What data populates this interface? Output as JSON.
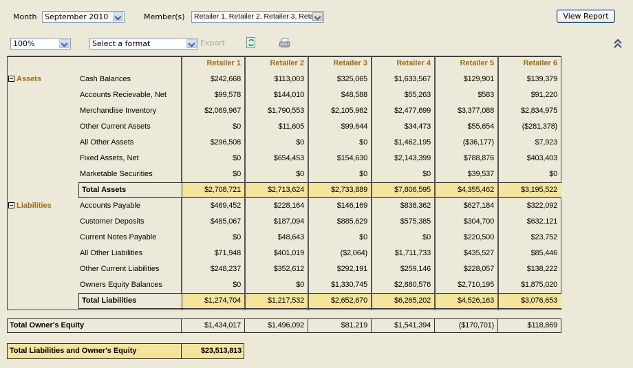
{
  "toolbar": {
    "month_label": "Month",
    "month_value": "September 2010",
    "members_label": "Member(s)",
    "members_value": "Retailer 1, Retailer 2, Retailer 3, Retail",
    "view_report_label": "View Report",
    "zoom_value": "100%",
    "format_value": "Select a format",
    "export_label": "Export",
    "icons": [
      "refresh-icon",
      "print-icon",
      "collapse-up-icon"
    ]
  },
  "report": {
    "columns": [
      "Retailer 1",
      "Retailer 2",
      "Retailer 3",
      "Retailer 4",
      "Retailer 5",
      "Retailer 6"
    ],
    "assets": {
      "label": "Assets",
      "rows": [
        {
          "label": "Cash Balances",
          "values": [
            "$242,668",
            "$113,003",
            "$325,065",
            "$1,633,567",
            "$129,901",
            "$139,379"
          ]
        },
        {
          "label": "Accounts Recievable, Net",
          "values": [
            "$99,578",
            "$144,010",
            "$48,588",
            "$55,263",
            "$583",
            "$91,220"
          ]
        },
        {
          "label": "Merchandise Inventory",
          "values": [
            "$2,069,967",
            "$1,790,553",
            "$2,105,962",
            "$2,477,699",
            "$3,377,088",
            "$2,834,975"
          ]
        },
        {
          "label": "Other Current Assets",
          "values": [
            "$0",
            "$11,605",
            "$99,644",
            "$34,473",
            "$55,654",
            "($281,378)"
          ]
        },
        {
          "label": "All Other Assets",
          "values": [
            "$296,508",
            "$0",
            "$0",
            "$1,462,195",
            "($36,177)",
            "$7,923"
          ]
        },
        {
          "label": "Fixed Assets, Net",
          "values": [
            "$0",
            "$654,453",
            "$154,630",
            "$2,143,399",
            "$788,876",
            "$403,403"
          ]
        },
        {
          "label": "Marketable Securities",
          "values": [
            "$0",
            "$0",
            "$0",
            "$0",
            "$39,537",
            "$0"
          ]
        }
      ],
      "total": {
        "label": "Total Assets",
        "values": [
          "$2,708,721",
          "$2,713,624",
          "$2,733,889",
          "$7,806,595",
          "$4,355,462",
          "$3,195,522"
        ]
      }
    },
    "liabilities": {
      "label": "Liabilities",
      "rows": [
        {
          "label": "Accounts Payable",
          "values": [
            "$469,452",
            "$228,164",
            "$146,169",
            "$838,362",
            "$627,184",
            "$322,092"
          ]
        },
        {
          "label": "Customer Deposits",
          "values": [
            "$485,067",
            "$187,094",
            "$885,629",
            "$575,385",
            "$304,700",
            "$632,121"
          ]
        },
        {
          "label": "Current Notes Payable",
          "values": [
            "$0",
            "$48,643",
            "$0",
            "$0",
            "$220,500",
            "$23,752"
          ]
        },
        {
          "label": "All Other Liabilities",
          "values": [
            "$71,948",
            "$401,019",
            "($2,064)",
            "$1,711,733",
            "$435,527",
            "$85,446"
          ]
        },
        {
          "label": "Other Current Liabilities",
          "values": [
            "$248,237",
            "$352,612",
            "$292,191",
            "$259,146",
            "$228,057",
            "$138,222"
          ]
        },
        {
          "label": "Owners Equity Balances",
          "values": [
            "$0",
            "$0",
            "$1,330,745",
            "$2,880,576",
            "$2,710,195",
            "$1,875,020"
          ]
        }
      ],
      "total": {
        "label": "Total Liabilities",
        "values": [
          "$1,274,704",
          "$1,217,532",
          "$2,652,670",
          "$6,265,202",
          "$4,526,163",
          "$3,076,653"
        ]
      }
    },
    "owners_equity": {
      "label": "Total Owner's Equity",
      "values": [
        "$1,434,017",
        "$1,496,092",
        "$81,219",
        "$1,541,394",
        "($170,701)",
        "$118,869"
      ]
    },
    "grand_total": {
      "label": "Total Liabilities and Owner's Equity",
      "value": "$23,513,813"
    }
  },
  "colors": {
    "background": "#ECE9D8",
    "section_header": "#9C6B12",
    "total_highlight": "#F4E49C"
  }
}
